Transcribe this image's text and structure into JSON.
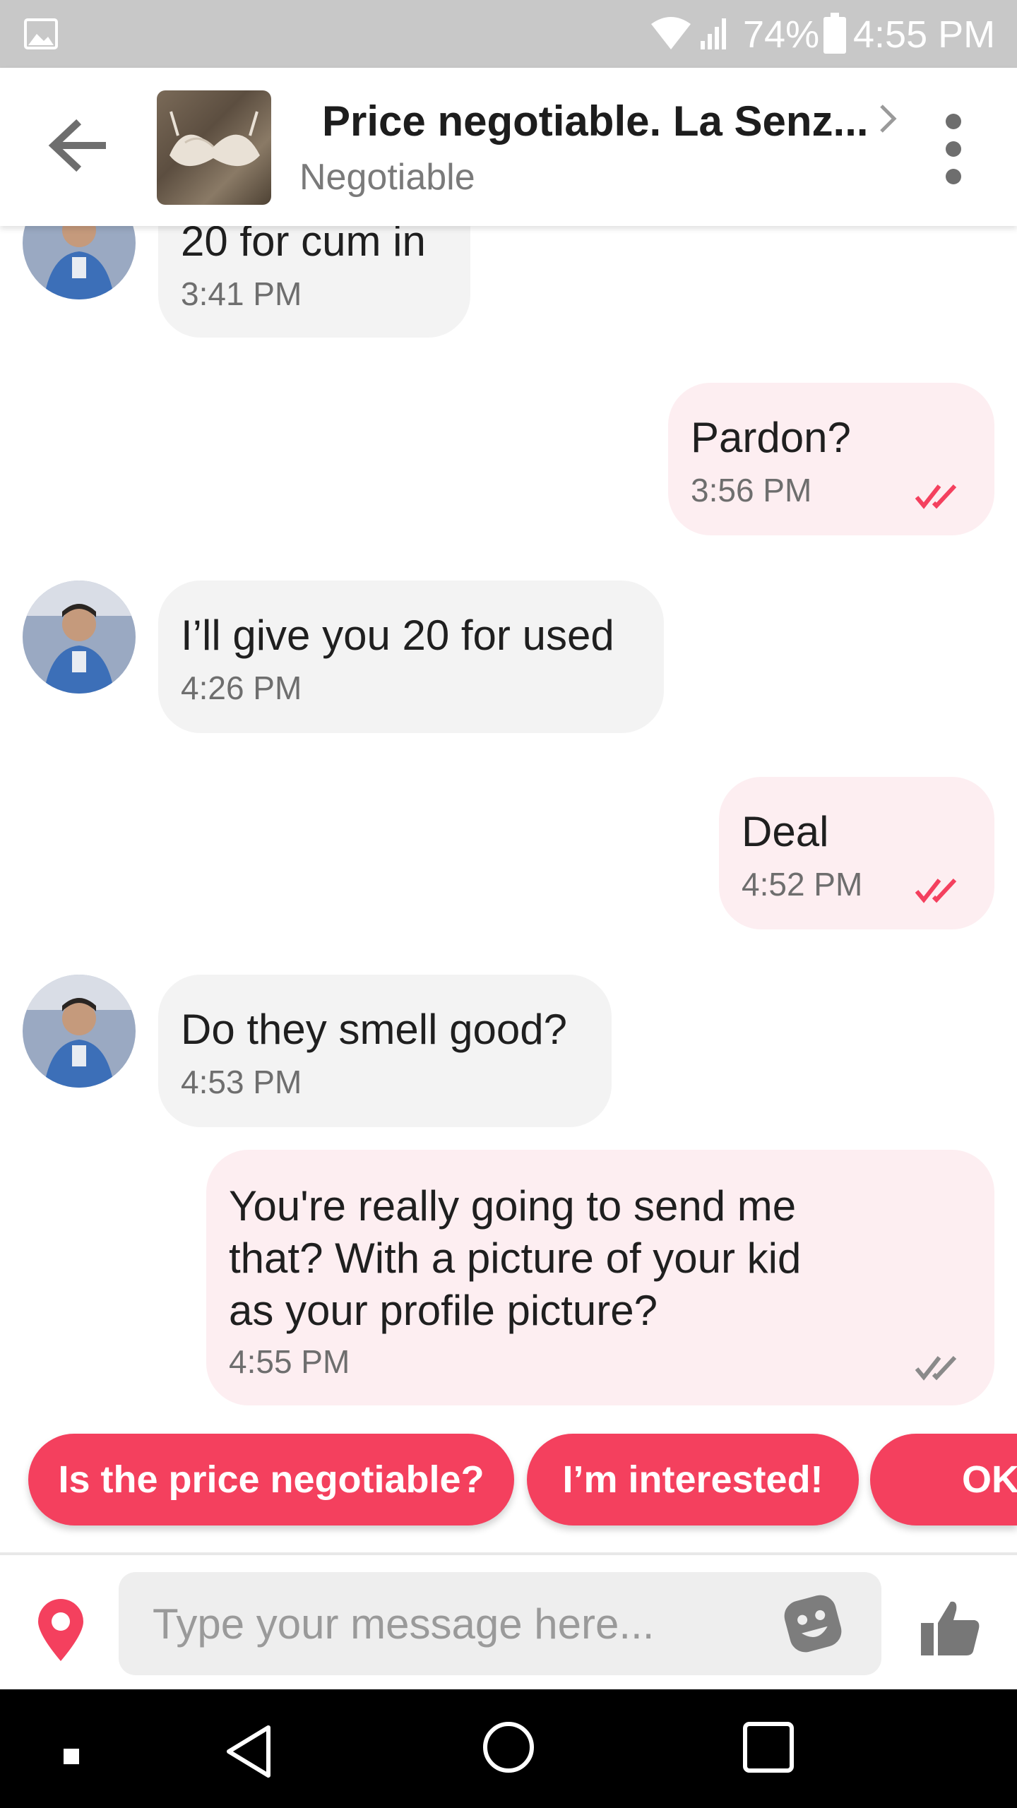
{
  "status_bar": {
    "battery_percent": "74%",
    "time": "4:55 PM",
    "icons": [
      "image-icon",
      "wifi-icon",
      "signal-icon",
      "battery-icon"
    ]
  },
  "header": {
    "title": "Price negotiable. La Senz...",
    "subtitle": "Negotiable",
    "icons": [
      "back-arrow-icon",
      "chevron-right-icon",
      "more-vert-icon"
    ]
  },
  "messages": [
    {
      "direction": "in",
      "text": "20 for cum in",
      "time": "3:41 PM"
    },
    {
      "direction": "out",
      "text": "Pardon?",
      "time": "3:56 PM",
      "read": true
    },
    {
      "direction": "in",
      "text": "I’ll give you 20 for used",
      "time": "4:26 PM"
    },
    {
      "direction": "out",
      "text": "Deal",
      "time": "4:52 PM",
      "read": true
    },
    {
      "direction": "in",
      "text": "Do they smell good?",
      "time": "4:53 PM"
    },
    {
      "direction": "out",
      "lines": [
        "You're really going to send me",
        "that? With a picture of your kid",
        "as your profile picture?"
      ],
      "time": "4:55 PM",
      "read": false
    }
  ],
  "quick_replies": [
    "Is the price negotiable?",
    "I’m interested!",
    "OK"
  ],
  "composer": {
    "placeholder": "Type your message here...",
    "icons": [
      "location-pin-icon",
      "emoji-icon",
      "thumbs-up-icon"
    ]
  },
  "nav_bar": {
    "icons": [
      "square-dot-icon",
      "back-triangle-icon",
      "home-circle-icon",
      "recents-square-icon"
    ]
  },
  "colors": {
    "accent": "#f4405e",
    "incoming_bubble": "#f3f3f3",
    "outgoing_bubble": "#fdeef1",
    "read_check": "#f4405e",
    "unread_check": "#8a8a8a",
    "status_bar": "#c8c8c8"
  }
}
